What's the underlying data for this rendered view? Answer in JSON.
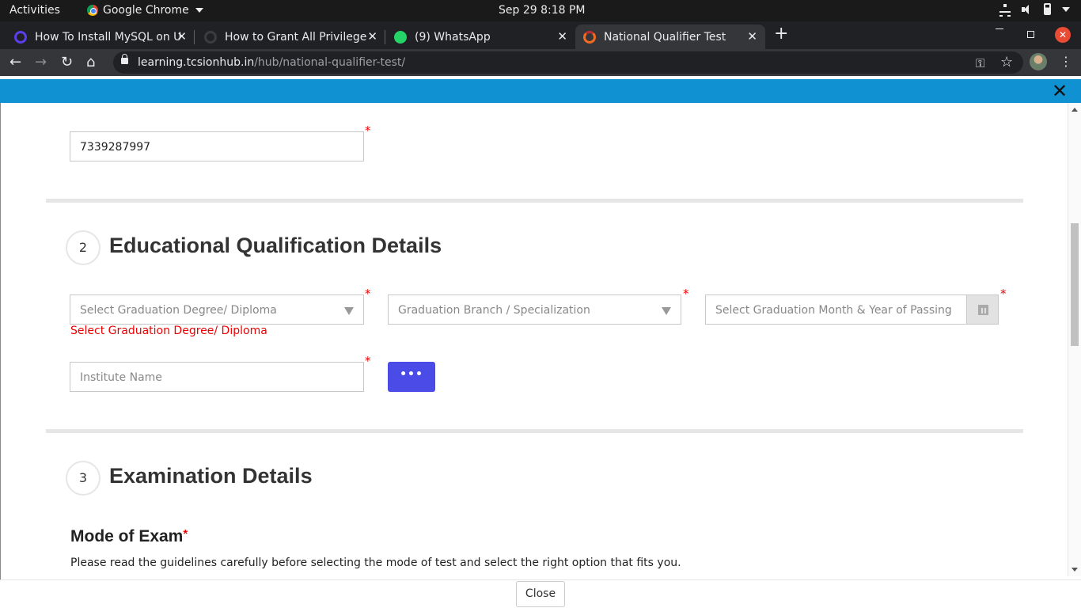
{
  "system_bar": {
    "activities": "Activities",
    "app_name": "Google Chrome",
    "clock": "Sep 29   8:18 PM"
  },
  "tabs": [
    {
      "label": "How To Install MySQL on U",
      "favicon_color": "#5b3ee8",
      "active": false
    },
    {
      "label": "How to Grant All Privilege",
      "favicon_color": "#3c3c3c",
      "active": false
    },
    {
      "label": "(9) WhatsApp",
      "favicon_color": "#25d366",
      "active": false
    },
    {
      "label": "National Qualifier Test",
      "favicon_color": "#f26b21",
      "active": true
    }
  ],
  "address_bar": {
    "domain": "learning.tcsionhub.in",
    "path": "/hub/national-qualifier-test/"
  },
  "form": {
    "phone_value": "7339287997",
    "section2": {
      "step": "2",
      "title": "Educational Qualification Details",
      "degree_placeholder": "Select Graduation Degree/ Diploma",
      "branch_placeholder": "Graduation Branch / Specialization",
      "passing_placeholder": "Select Graduation Month & Year of Passing",
      "degree_error": "Select Graduation Degree/ Diploma",
      "institute_placeholder": "Institute Name",
      "more_label": "•••"
    },
    "section3": {
      "step": "3",
      "title": "Examination Details",
      "mode_label": "Mode of Exam",
      "guidelines": "Please read the guidelines carefully before selecting the mode of test and select the right option that fits you."
    },
    "required_marker": "*"
  },
  "footer": {
    "close_label": "Close"
  },
  "colors": {
    "header_blue": "#1091d1",
    "accent_button": "#4b4be8",
    "error_red": "#ee0000"
  }
}
